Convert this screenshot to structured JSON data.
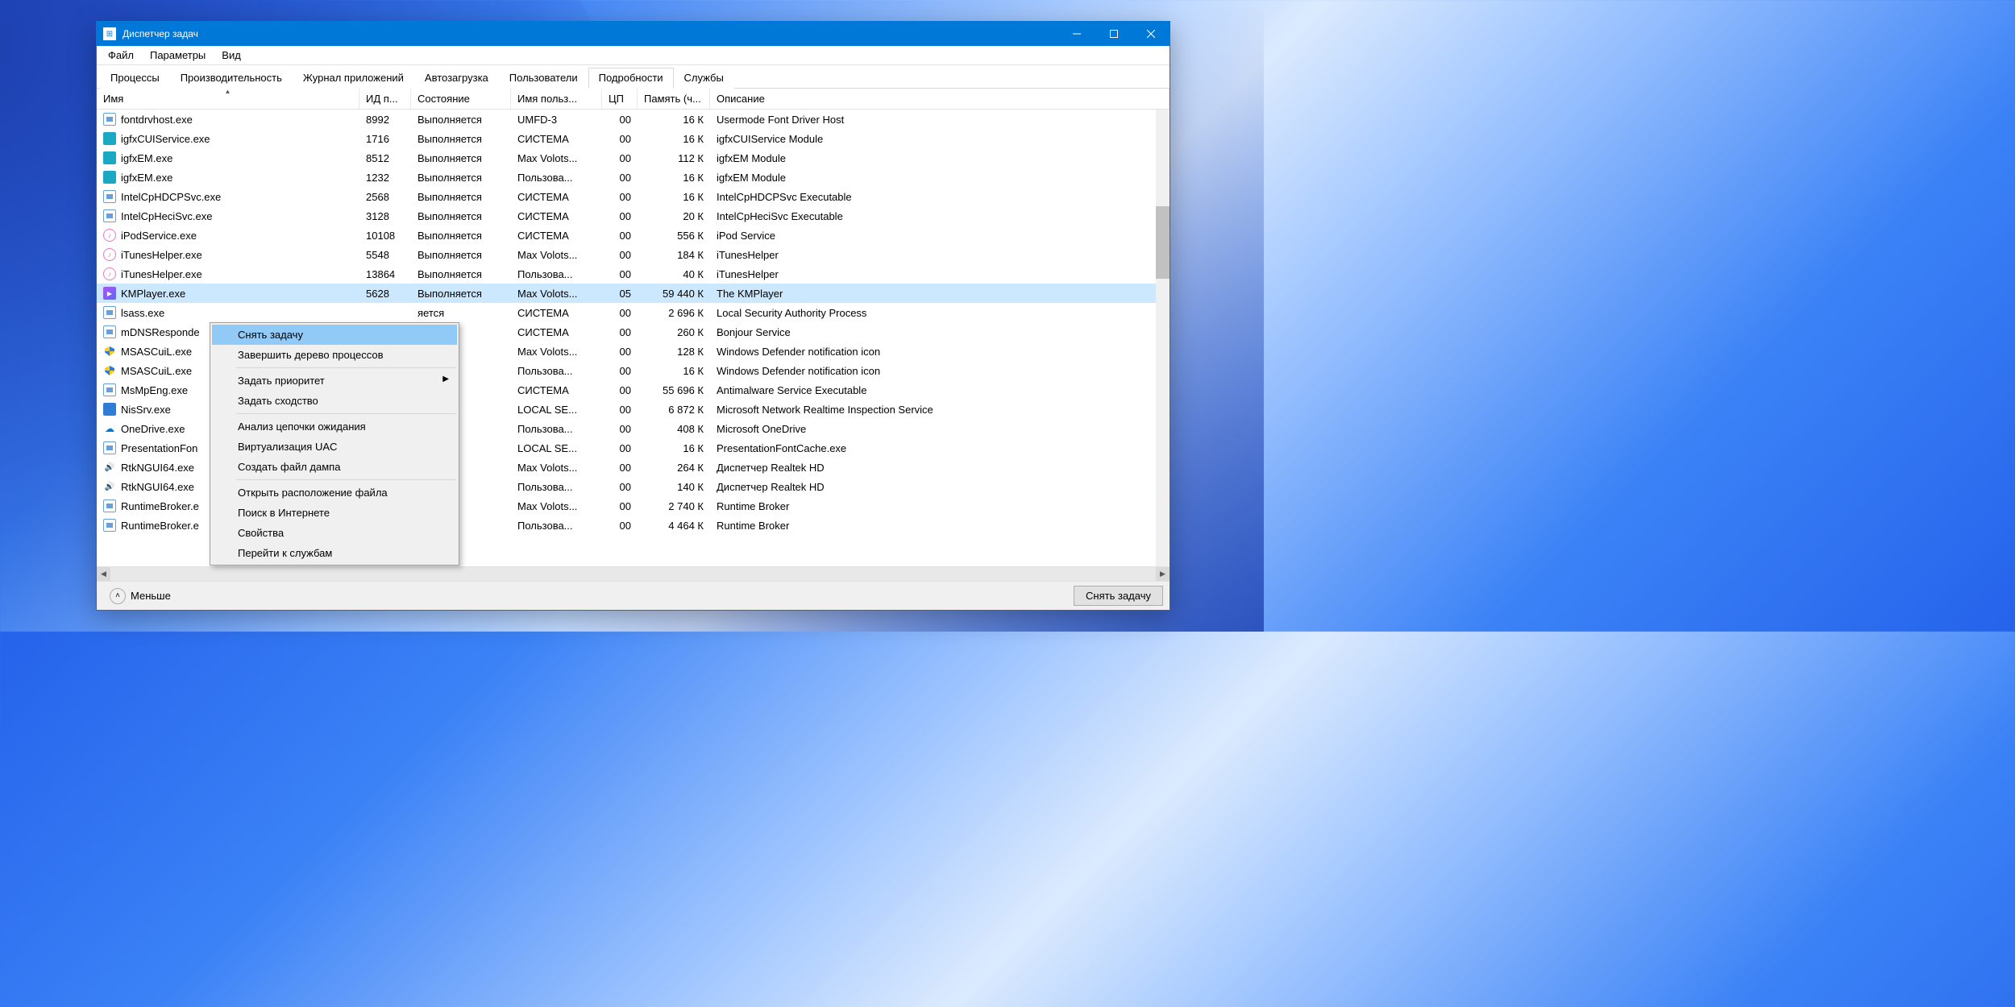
{
  "window": {
    "title": "Диспетчер задач"
  },
  "menu": {
    "file": "Файл",
    "options": "Параметры",
    "view": "Вид"
  },
  "tabs": {
    "processes": "Процессы",
    "performance": "Производительность",
    "apphistory": "Журнал приложений",
    "startup": "Автозагрузка",
    "users": "Пользователи",
    "details": "Подробности",
    "services": "Службы"
  },
  "columns": {
    "name": "Имя",
    "pid": "ИД п...",
    "state": "Состояние",
    "user": "Имя польз...",
    "cpu": "ЦП",
    "mem": "Память (ч...",
    "desc": "Описание"
  },
  "rows": [
    {
      "icon": "ic-generic",
      "name": "fontdrvhost.exe",
      "pid": "8992",
      "state": "Выполняется",
      "user": "UMFD-3",
      "cpu": "00",
      "mem": "16 К",
      "desc": "Usermode Font Driver Host"
    },
    {
      "icon": "ic-teal",
      "name": "igfxCUIService.exe",
      "pid": "1716",
      "state": "Выполняется",
      "user": "СИСТЕМА",
      "cpu": "00",
      "mem": "16 К",
      "desc": "igfxCUIService Module"
    },
    {
      "icon": "ic-teal",
      "name": "igfxEM.exe",
      "pid": "8512",
      "state": "Выполняется",
      "user": "Max Volots...",
      "cpu": "00",
      "mem": "112 К",
      "desc": "igfxEM Module"
    },
    {
      "icon": "ic-teal",
      "name": "igfxEM.exe",
      "pid": "1232",
      "state": "Выполняется",
      "user": "Пользова...",
      "cpu": "00",
      "mem": "16 К",
      "desc": "igfxEM Module"
    },
    {
      "icon": "ic-generic",
      "name": "IntelCpHDCPSvc.exe",
      "pid": "2568",
      "state": "Выполняется",
      "user": "СИСТЕМА",
      "cpu": "00",
      "mem": "16 К",
      "desc": "IntelCpHDCPSvc Executable"
    },
    {
      "icon": "ic-generic",
      "name": "IntelCpHeciSvc.exe",
      "pid": "3128",
      "state": "Выполняется",
      "user": "СИСТЕМА",
      "cpu": "00",
      "mem": "20 К",
      "desc": "IntelCpHeciSvc Executable"
    },
    {
      "icon": "ic-itunes",
      "name": "iPodService.exe",
      "pid": "10108",
      "state": "Выполняется",
      "user": "СИСТЕМА",
      "cpu": "00",
      "mem": "556 К",
      "desc": "iPod Service"
    },
    {
      "icon": "ic-itunes",
      "name": "iTunesHelper.exe",
      "pid": "5548",
      "state": "Выполняется",
      "user": "Max Volots...",
      "cpu": "00",
      "mem": "184 К",
      "desc": "iTunesHelper"
    },
    {
      "icon": "ic-itunes",
      "name": "iTunesHelper.exe",
      "pid": "13864",
      "state": "Выполняется",
      "user": "Пользова...",
      "cpu": "00",
      "mem": "40 К",
      "desc": "iTunesHelper"
    },
    {
      "icon": "ic-kmp",
      "name": "KMPlayer.exe",
      "pid": "5628",
      "state": "Выполняется",
      "user": "Max Volots...",
      "cpu": "05",
      "mem": "59 440 К",
      "desc": "The KMPlayer",
      "selected": true
    },
    {
      "icon": "ic-generic",
      "name": "lsass.exe",
      "pid": "",
      "state": "яется",
      "user": "СИСТЕМА",
      "cpu": "00",
      "mem": "2 696 К",
      "desc": "Local Security Authority Process"
    },
    {
      "icon": "ic-generic",
      "name": "mDNSRespondе",
      "pid": "",
      "state": "яется",
      "user": "СИСТЕМА",
      "cpu": "00",
      "mem": "260 К",
      "desc": "Bonjour Service"
    },
    {
      "icon": "ic-shield",
      "name": "MSASCuiL.exe",
      "pid": "",
      "state": "яется",
      "user": "Max Volots...",
      "cpu": "00",
      "mem": "128 К",
      "desc": "Windows Defender notification icon"
    },
    {
      "icon": "ic-shield",
      "name": "MSASCuiL.exe",
      "pid": "",
      "state": "яется",
      "user": "Пользова...",
      "cpu": "00",
      "mem": "16 К",
      "desc": "Windows Defender notification icon"
    },
    {
      "icon": "ic-generic",
      "name": "MsMpEng.exe",
      "pid": "",
      "state": "яется",
      "user": "СИСТЕМА",
      "cpu": "00",
      "mem": "55 696 К",
      "desc": "Antimalware Service Executable"
    },
    {
      "icon": "ic-blue",
      "name": "NisSrv.exe",
      "pid": "",
      "state": "яется",
      "user": "LOCAL SE...",
      "cpu": "00",
      "mem": "6 872 К",
      "desc": "Microsoft Network Realtime Inspection Service"
    },
    {
      "icon": "ic-cloud",
      "name": "OneDrive.exe",
      "pid": "",
      "state": "яется",
      "user": "Пользова...",
      "cpu": "00",
      "mem": "408 К",
      "desc": "Microsoft OneDrive"
    },
    {
      "icon": "ic-generic",
      "name": "PresentationFon",
      "pid": "",
      "state": "яется",
      "user": "LOCAL SE...",
      "cpu": "00",
      "mem": "16 К",
      "desc": "PresentationFontCache.exe"
    },
    {
      "icon": "ic-realtek",
      "name": "RtkNGUI64.exe",
      "pid": "",
      "state": "яется",
      "user": "Max Volots...",
      "cpu": "00",
      "mem": "264 К",
      "desc": "Диспетчер Realtek HD"
    },
    {
      "icon": "ic-realtek",
      "name": "RtkNGUI64.exe",
      "pid": "",
      "state": "яется",
      "user": "Пользова...",
      "cpu": "00",
      "mem": "140 К",
      "desc": "Диспетчер Realtek HD"
    },
    {
      "icon": "ic-generic",
      "name": "RuntimeBroker.е",
      "pid": "",
      "state": "яется",
      "user": "Max Volots...",
      "cpu": "00",
      "mem": "2 740 К",
      "desc": "Runtime Broker"
    },
    {
      "icon": "ic-generic",
      "name": "RuntimeBroker.е",
      "pid": "",
      "state": "яется",
      "user": "Пользова...",
      "cpu": "00",
      "mem": "4 464 К",
      "desc": "Runtime Broker"
    }
  ],
  "context_menu": {
    "end_task": "Снять задачу",
    "end_tree": "Завершить дерево процессов",
    "priority": "Задать приоритет",
    "affinity": "Задать сходство",
    "analyze": "Анализ цепочки ожидания",
    "uac": "Виртуализация UAC",
    "dump": "Создать файл дампа",
    "open_loc": "Открыть расположение файла",
    "search": "Поиск в Интернете",
    "props": "Свойства",
    "goto": "Перейти к службам"
  },
  "footer": {
    "fewer": "Меньше",
    "end_task": "Снять задачу"
  }
}
